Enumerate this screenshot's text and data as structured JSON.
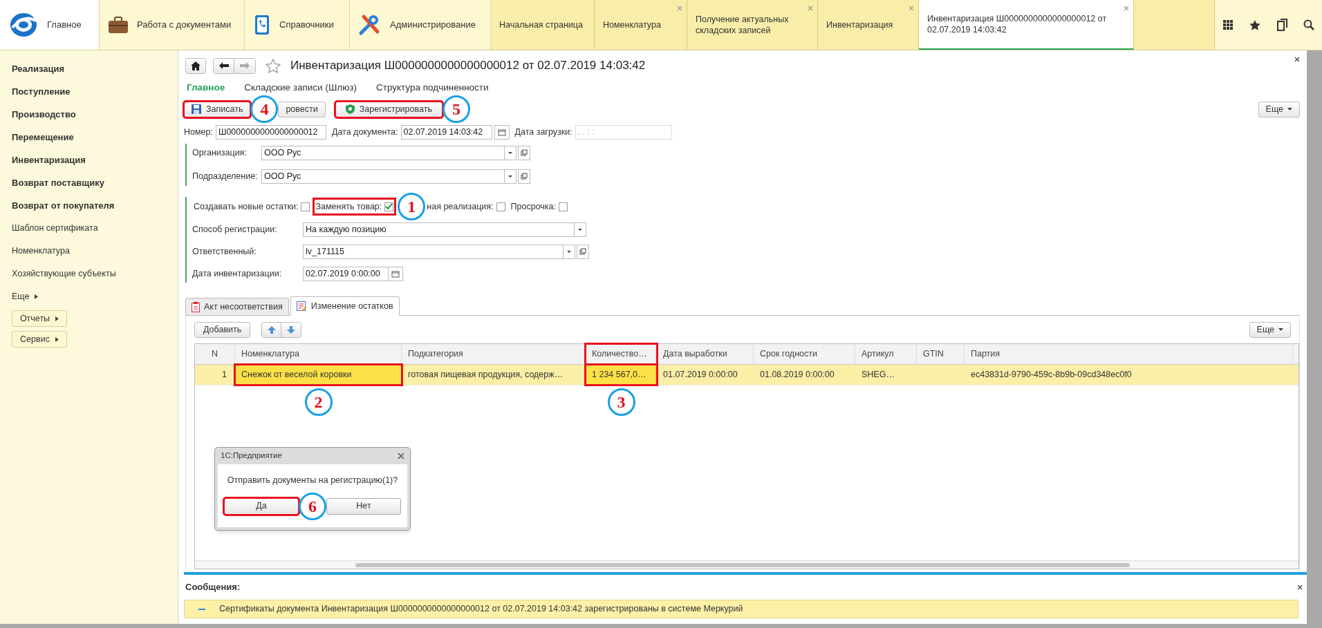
{
  "top_sections": [
    {
      "label": "Главное",
      "selected": true
    },
    {
      "label": "Работа с документами",
      "selected": false
    },
    {
      "label": "Справочники",
      "selected": false
    },
    {
      "label": "Администрирование",
      "selected": false
    }
  ],
  "open_tabs": [
    {
      "label": "Начальная страница",
      "selected": false,
      "closable": false
    },
    {
      "label": "Номенклатура",
      "selected": false,
      "closable": true
    },
    {
      "label": "Получение актуальных складских записей",
      "selected": false,
      "closable": true
    },
    {
      "label": "Инвентаризация",
      "selected": false,
      "closable": true
    },
    {
      "label": "Инвентаризация Ш0000000000000000012 от 02.07.2019 14:03:42",
      "selected": true,
      "closable": true
    }
  ],
  "sidebar": {
    "items": [
      {
        "label": "Реализация",
        "kind": "section"
      },
      {
        "label": "Поступление",
        "kind": "section"
      },
      {
        "label": "Производство",
        "kind": "section"
      },
      {
        "label": "Перемещение",
        "kind": "section"
      },
      {
        "label": "Инвентаризация",
        "kind": "section"
      },
      {
        "label": "Возврат поставщику",
        "kind": "section"
      },
      {
        "label": "Возврат от покупателя",
        "kind": "section"
      },
      {
        "label": "Шаблон сертификата",
        "kind": "command"
      },
      {
        "label": "Номенклатура",
        "kind": "command"
      },
      {
        "label": "Хозяйствующие субъекты",
        "kind": "command"
      },
      {
        "label": "Еще",
        "kind": "more"
      },
      {
        "label": "Отчеты",
        "kind": "menu_button"
      },
      {
        "label": "Сервис",
        "kind": "menu_button"
      }
    ]
  },
  "document": {
    "title": "Инвентаризация Ш0000000000000000012 от 02.07.2019 14:03:42",
    "tabs": [
      {
        "label": "Главное",
        "selected": true
      },
      {
        "label": "Складские записи (Шлюз)",
        "selected": false
      },
      {
        "label": "Структура подчиненности",
        "selected": false
      }
    ],
    "toolbar": [
      {
        "label": "Записать",
        "marked": true,
        "callout": "4"
      },
      {
        "label": "ровести",
        "marked": false
      },
      {
        "label": "Зарегистрировать",
        "marked": true,
        "callout": "5"
      }
    ],
    "more_button": "Еще",
    "header_fields": [
      {
        "label": "Номер:",
        "value": "Ш0000000000000000012",
        "kind": "text"
      },
      {
        "label": "Дата документа:",
        "value": "02.07.2019 14:03:42",
        "kind": "date"
      },
      {
        "label": "Дата загрузки:",
        "placeholder": " .  .     :  :",
        "kind": "text_disabled"
      }
    ],
    "org_fields": [
      {
        "label": "Организация:",
        "value": "ООО Рус"
      },
      {
        "label": "Подразделение:",
        "value": "ООО Рус"
      }
    ],
    "checkboxes": [
      {
        "label": "Создавать новые остатки:",
        "checked": false,
        "marked": false
      },
      {
        "label": "Заменять товар:",
        "checked": true,
        "marked": true,
        "callout": "1"
      },
      {
        "label": "ная реализация:",
        "checked": false,
        "marked": false
      },
      {
        "label": "Просрочка:",
        "checked": false,
        "marked": false
      }
    ],
    "fields": [
      {
        "label": "Способ регистрации:",
        "value": "На каждую позицию",
        "kind": "select"
      },
      {
        "label": "Ответственный:",
        "value": "lv_171115",
        "kind": "reference"
      },
      {
        "label": "Дата инвентаризации:",
        "value": "02.07.2019  0:00:00",
        "kind": "date"
      }
    ],
    "detail_tabs": [
      {
        "label": "Акт несоответствия",
        "selected": false
      },
      {
        "label": "Изменение остатков",
        "selected": true
      }
    ],
    "table_toolbar": {
      "add": "Добавить",
      "more": "Еще"
    },
    "table": {
      "columns": [
        {
          "label": "N",
          "marked": false
        },
        {
          "label": "Номенклатура",
          "marked": false
        },
        {
          "label": "Подкатегория",
          "marked": false
        },
        {
          "label": "Количество…",
          "marked": true
        },
        {
          "label": "Дата выработки",
          "marked": false
        },
        {
          "label": "Срок годности",
          "marked": false
        },
        {
          "label": "Артикул",
          "marked": false
        },
        {
          "label": "GTIN",
          "marked": false
        },
        {
          "label": "Партия",
          "marked": false
        }
      ],
      "rows": [
        {
          "selected": true,
          "cells": [
            {
              "text": "1",
              "marked": false
            },
            {
              "text": "Снежок от веселой коровки",
              "marked": true,
              "callout": "2"
            },
            {
              "text": "готовая пищевая продукция, содерж…",
              "marked": false
            },
            {
              "text": "1 234 567,0…",
              "marked": true,
              "callout": "3"
            },
            {
              "text": "01.07.2019 0:00:00",
              "marked": false
            },
            {
              "text": "01.08.2019 0:00:00",
              "marked": false
            },
            {
              "text": "SHEG…",
              "marked": false
            },
            {
              "text": null
            },
            {
              "text": "ec43831d-9790-459c-8b9b-09cd348ec0f0",
              "marked": false
            }
          ]
        }
      ]
    },
    "dialog": {
      "title": "1С:Предприятие",
      "message": "Отправить документы на регистрацию(1)?",
      "buttons": [
        {
          "label": "Да",
          "marked": true,
          "callout": "6"
        },
        {
          "label": "Нет",
          "marked": false
        }
      ]
    }
  },
  "messages": {
    "title": "Сообщения:",
    "items": [
      "Сертификаты документа Инвентаризация Ш0000000000000000012 от 02.07.2019 14:03:42 зарегистрированы в системе Меркурий"
    ]
  }
}
